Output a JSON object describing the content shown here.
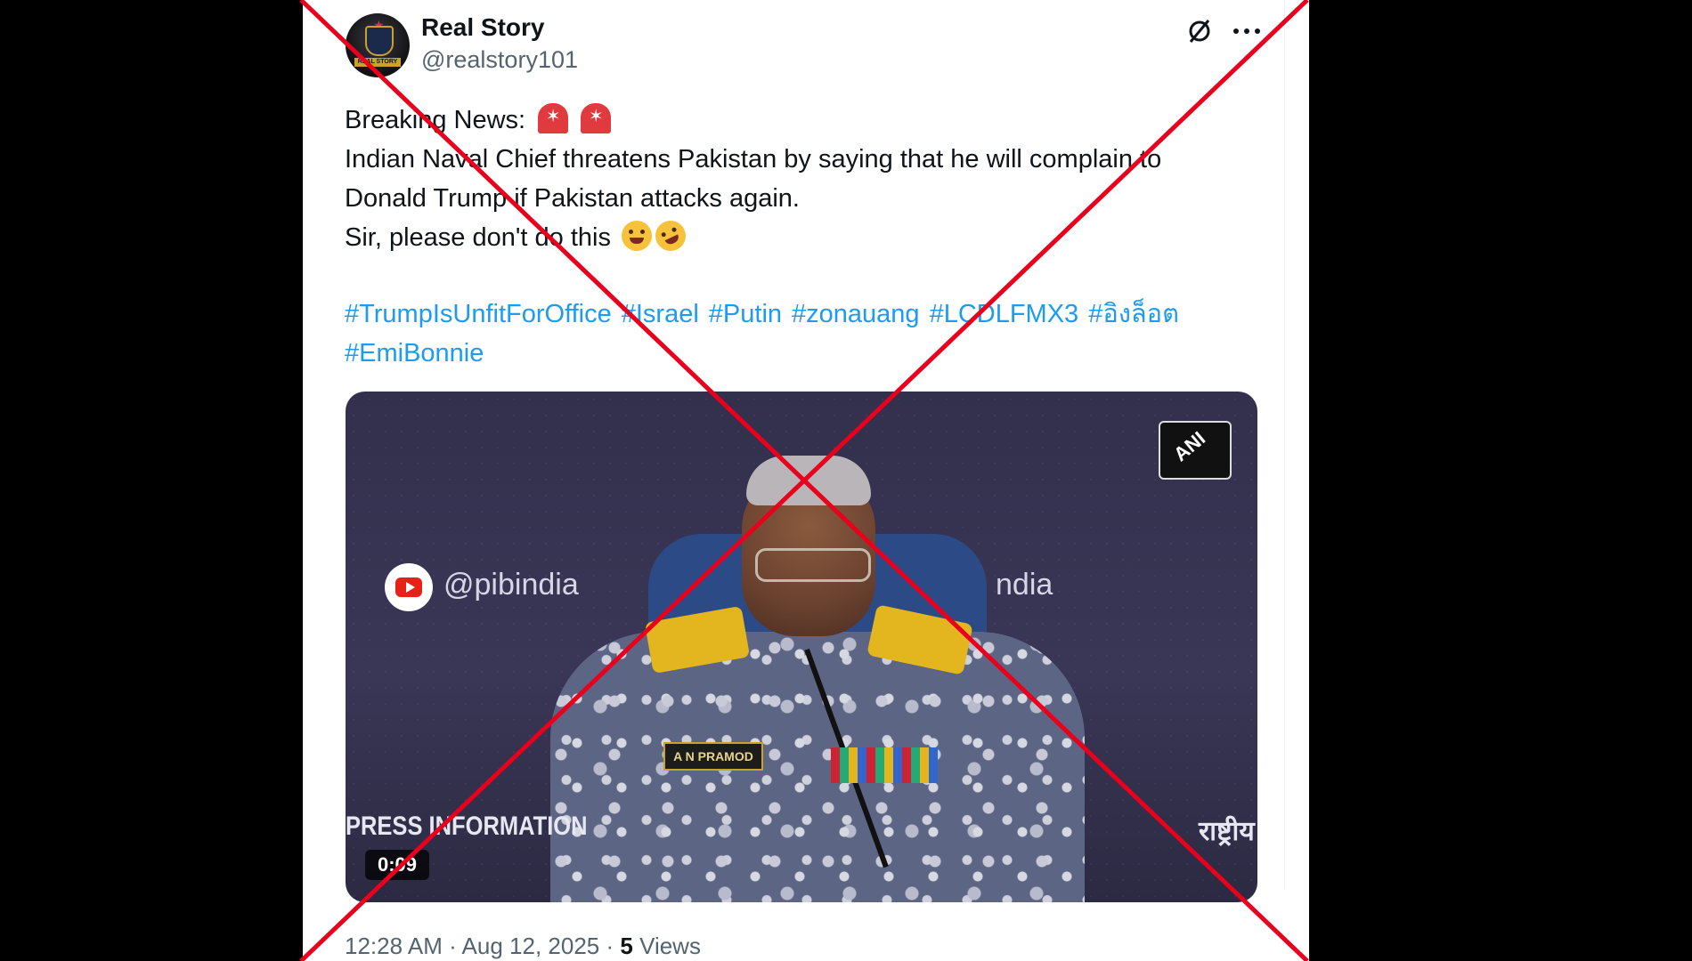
{
  "post": {
    "author": {
      "display_name": "Real Story",
      "handle": "@realstory101",
      "avatar_text": "REAL STORY"
    },
    "text_lines": [
      "Breaking News:",
      "Indian Naval Chief threatens Pakistan by saying that he will complain to",
      "Donald Trump if Pakistan attacks again.",
      "Sir, please don't do this"
    ],
    "hashtags_line1": [
      "#TrumpIsUnfitForOffice",
      "#Israel",
      "#Putin",
      "#zonauang",
      "#LCDLFMX3",
      "#อิงล็อต"
    ],
    "hashtags_line2": [
      "#EmiBonnie"
    ],
    "icons": [
      "grok-icon",
      "more-icon",
      "siren-emoji",
      "winking-tongue-emoji",
      "rofl-emoji"
    ],
    "video": {
      "watermark_handle": "@pibindia",
      "watermark_handle_partial": "ndia",
      "banner_text": "PRESS INFORMATION",
      "banner_text_hindi": "राष्ट्रीय",
      "agency_logo": "ANI",
      "name_tag": "A N PRAMOD",
      "duration": "0:09"
    },
    "meta": {
      "time": "12:28 AM",
      "date": "Aug 12, 2025",
      "views_count": "5",
      "views_label": "Views"
    }
  },
  "overlay": {
    "type": "red-cross",
    "color": "#e8001c"
  }
}
